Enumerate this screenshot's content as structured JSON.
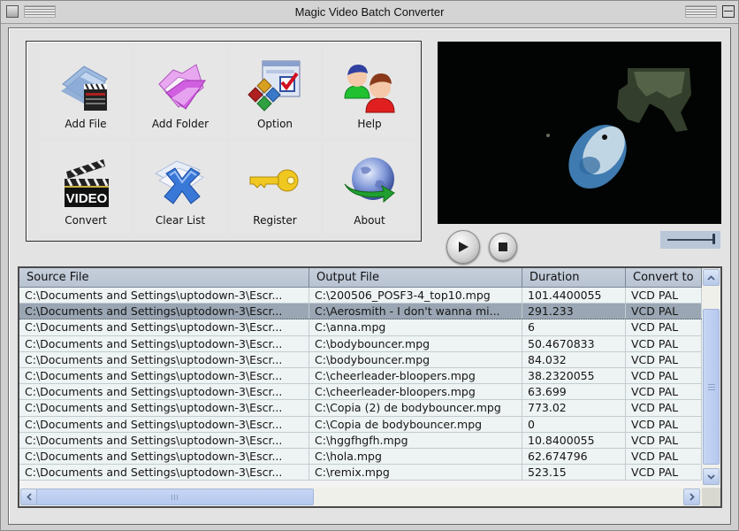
{
  "window": {
    "title": "Magic Video Batch Converter"
  },
  "toolbar": {
    "buttons": [
      {
        "id": "add-file",
        "label": "Add File",
        "icon": "folder-clapperboard-icon"
      },
      {
        "id": "add-folder",
        "label": "Add Folder",
        "icon": "purple-folder-icon"
      },
      {
        "id": "option",
        "label": "Option",
        "icon": "options-checkbox-icon"
      },
      {
        "id": "help",
        "label": "Help",
        "icon": "users-icon"
      },
      {
        "id": "convert",
        "label": "Convert",
        "icon": "video-clapperboard-icon"
      },
      {
        "id": "clear-list",
        "label": "Clear List",
        "icon": "clear-x-icon"
      },
      {
        "id": "register",
        "label": "Register",
        "icon": "key-icon"
      },
      {
        "id": "about",
        "label": "About",
        "icon": "globe-arrow-icon"
      }
    ]
  },
  "player": {
    "play_icon": "play-icon",
    "stop_icon": "stop-icon",
    "volume_level": 1.0
  },
  "file_list": {
    "columns": [
      "Source File",
      "Output File",
      "Duration",
      "Convert to"
    ],
    "selected_index": 1,
    "rows": [
      {
        "source": "C:\\Documents and Settings\\uptodown-3\\Escr...",
        "output": "C:\\200506_POSF3-4_top10.mpg",
        "duration": "101.4400055",
        "convert_to": "VCD PAL"
      },
      {
        "source": "C:\\Documents and Settings\\uptodown-3\\Escr...",
        "output": "C:\\Aerosmith - I don't wanna mi...",
        "duration": "291.233",
        "convert_to": "VCD PAL"
      },
      {
        "source": "C:\\Documents and Settings\\uptodown-3\\Escr...",
        "output": "C:\\anna.mpg",
        "duration": "6",
        "convert_to": "VCD PAL"
      },
      {
        "source": "C:\\Documents and Settings\\uptodown-3\\Escr...",
        "output": "C:\\bodybouncer.mpg",
        "duration": "50.4670833",
        "convert_to": "VCD PAL"
      },
      {
        "source": "C:\\Documents and Settings\\uptodown-3\\Escr...",
        "output": "C:\\bodybouncer.mpg",
        "duration": "84.032",
        "convert_to": "VCD PAL"
      },
      {
        "source": "C:\\Documents and Settings\\uptodown-3\\Escr...",
        "output": "C:\\cheerleader-bloopers.mpg",
        "duration": "38.2320055",
        "convert_to": "VCD PAL"
      },
      {
        "source": "C:\\Documents and Settings\\uptodown-3\\Escr...",
        "output": "C:\\cheerleader-bloopers.mpg",
        "duration": "63.699",
        "convert_to": "VCD PAL"
      },
      {
        "source": "C:\\Documents and Settings\\uptodown-3\\Escr...",
        "output": "C:\\Copia (2) de bodybouncer.mpg",
        "duration": "773.02",
        "convert_to": "VCD PAL"
      },
      {
        "source": "C:\\Documents and Settings\\uptodown-3\\Escr...",
        "output": "C:\\Copia de bodybouncer.mpg",
        "duration": "0",
        "convert_to": "VCD PAL"
      },
      {
        "source": "C:\\Documents and Settings\\uptodown-3\\Escr...",
        "output": "C:\\hggfhgfh.mpg",
        "duration": "10.8400055",
        "convert_to": "VCD PAL"
      },
      {
        "source": "C:\\Documents and Settings\\uptodown-3\\Escr...",
        "output": "C:\\hola.mpg",
        "duration": "62.674796",
        "convert_to": "VCD PAL"
      },
      {
        "source": "C:\\Documents and Settings\\uptodown-3\\Escr...",
        "output": "C:\\remix.mpg",
        "duration": "523.15",
        "convert_to": "VCD PAL"
      }
    ]
  },
  "scrollbars": {
    "up_glyph": "⌃",
    "down_glyph": "⌄",
    "left_glyph": "‹",
    "right_glyph": "›"
  }
}
